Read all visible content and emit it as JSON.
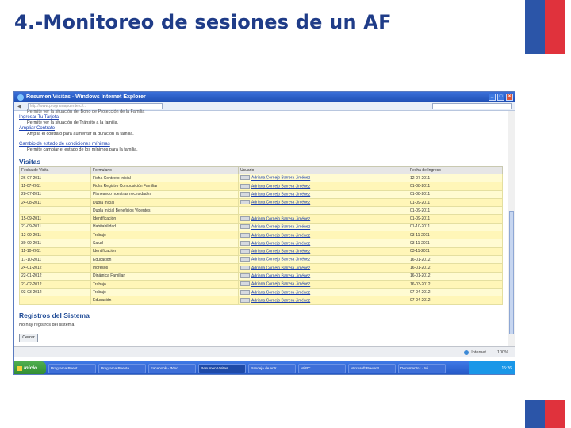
{
  "slide": {
    "title": "4.-Monitoreo de sesiones de un AF"
  },
  "browser": {
    "window_title": "Resumen Visitas - Windows Internet Explorer",
    "address": "http://www.programapuente.cl/..."
  },
  "links": [
    {
      "label": "",
      "desc": "Permite ver la situación del Bono de Protección de la Familia"
    },
    {
      "label": "Ingresar Tu Tarjeta",
      "desc": "Permite ver la situación de Tránsito a la familia."
    },
    {
      "label": "Ampliar Contrato",
      "desc": "Amplía el contrato para aumentar la duración la familia."
    },
    {
      "label": "Cambio de estado de condiciones mínimas",
      "desc": "Permite cambiar el estado de los mínimos para la familia."
    }
  ],
  "visitas": {
    "title": "Visitas",
    "headers": [
      "Fecha de Visita",
      "Formulario",
      "Usuario",
      "Fecha de Ingreso"
    ],
    "rows": [
      {
        "fecha": "26-07-2011",
        "formulario": "Ficha Contexto Inicial",
        "usuario": "Adriana Cornejo Barrera Jiménez",
        "ingreso": "12-07-2011",
        "has_button": true
      },
      {
        "fecha": "11-07-2011",
        "formulario": "Ficha Registro Composición Familiar",
        "usuario": "Adriana Cornejo Barrera Jiménez",
        "ingreso": "01-08-2011",
        "has_button": true
      },
      {
        "fecha": "28-07-2011",
        "formulario": "Planeando nuestras necesidades",
        "usuario": "Adriana Cornejo Barrera Jiménez",
        "ingreso": "01-08-2011",
        "has_button": true
      },
      {
        "fecha": "24-08-2011",
        "formulario": "Dupla Inicial",
        "usuario": "Adriana Cornejo Barrera Jiménez",
        "ingreso": "01-09-2011",
        "has_button": true
      },
      {
        "fecha": "",
        "formulario": "Dupla Inicial Beneficios Vigentes",
        "usuario": "",
        "ingreso": "01-09-2011",
        "has_button": false
      },
      {
        "fecha": "15-09-2011",
        "formulario": "Identificación",
        "usuario": "Adriana Cornejo Barrera Jiménez",
        "ingreso": "01-09-2011",
        "has_button": true
      },
      {
        "fecha": "21-09-2011",
        "formulario": "Habitabilidad",
        "usuario": "Adriana Cornejo Barrera Jiménez",
        "ingreso": "01-10-2011",
        "has_button": true
      },
      {
        "fecha": "12-09-2011",
        "formulario": "Trabajo",
        "usuario": "Adriana Cornejo Barrera Jiménez",
        "ingreso": "03-11-2011",
        "has_button": true
      },
      {
        "fecha": "30-09-2011",
        "formulario": "Salud",
        "usuario": "Adriana Cornejo Barrera Jiménez",
        "ingreso": "03-11-2011",
        "has_button": true
      },
      {
        "fecha": "11-10-2011",
        "formulario": "Identificación",
        "usuario": "Adriana Cornejo Barrera Jiménez",
        "ingreso": "03-11-2011",
        "has_button": true
      },
      {
        "fecha": "17-10-2011",
        "formulario": "Educación",
        "usuario": "Adriana Cornejo Barrera Jiménez",
        "ingreso": "16-01-2012",
        "has_button": true
      },
      {
        "fecha": "24-01-2012",
        "formulario": "Ingresos",
        "usuario": "Adriana Cornejo Barrera Jiménez",
        "ingreso": "16-01-2012",
        "has_button": true
      },
      {
        "fecha": "22-01-2012",
        "formulario": "Dinámica Familiar",
        "usuario": "Adriana Cornejo Barrera Jiménez",
        "ingreso": "16-01-2012",
        "has_button": true
      },
      {
        "fecha": "21-02-2012",
        "formulario": "Trabajo",
        "usuario": "Adriana Cornejo Barrera Jiménez",
        "ingreso": "16-03-2012",
        "has_button": true
      },
      {
        "fecha": "03-03-2012",
        "formulario": "Trabajo",
        "usuario": "Adriana Cornejo Barrera Jiménez",
        "ingreso": "07-04-2012",
        "has_button": true
      },
      {
        "fecha": "",
        "formulario": "Educación",
        "usuario": "Adriana Cornejo Barrera Jiménez",
        "ingreso": "07-04-2012",
        "has_button": true
      }
    ]
  },
  "registros": {
    "title": "Registros del Sistema",
    "empty_text": "No hay registros del sistema",
    "close_label": "Cerrar"
  },
  "statusbar": {
    "zone": "Internet",
    "zoom": "100%"
  },
  "taskbar": {
    "start_label": "Inicio",
    "items": [
      "Programa Puent...",
      "Programa Puente...",
      "Facebook - Wind...",
      "Resumen Visitas ...",
      "Bandeja de entr...",
      "Mi PC",
      "Microsoft PowerP...",
      "Documento1 - Mi..."
    ],
    "active_index": 3,
    "clock": "15:26"
  }
}
